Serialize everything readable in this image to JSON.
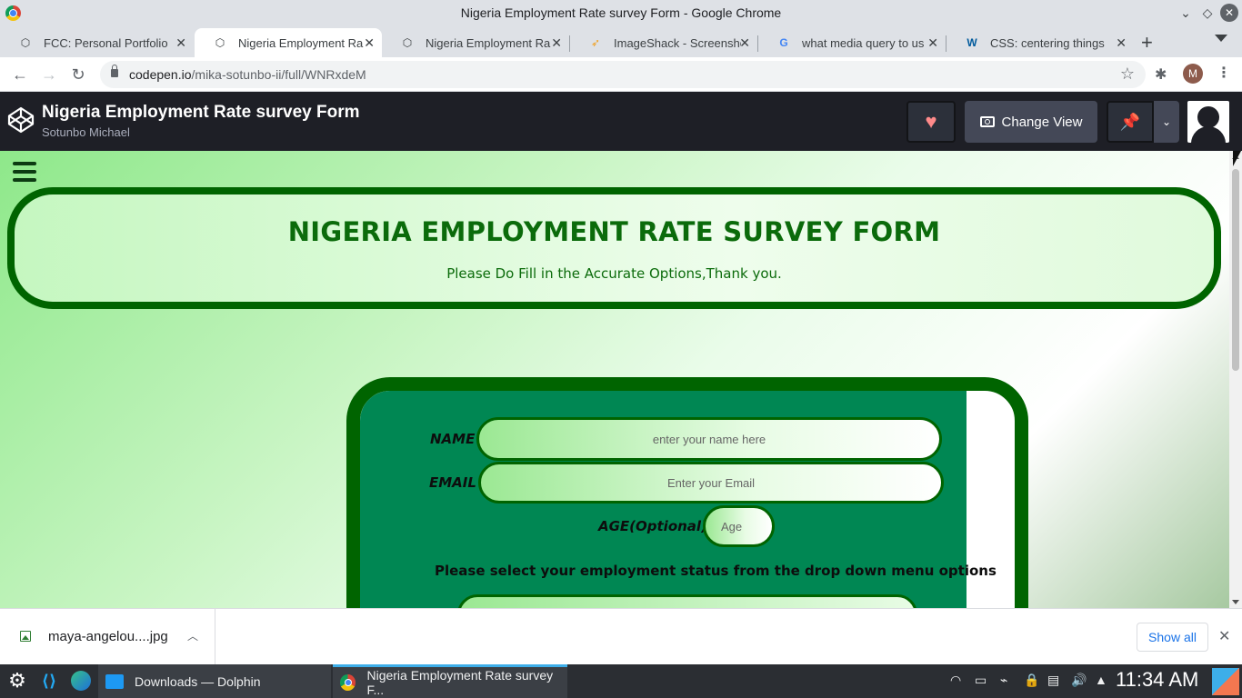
{
  "window": {
    "title": "Nigeria Employment Rate survey Form - Google Chrome"
  },
  "tabs": [
    {
      "label": "FCC: Personal Portfolio",
      "icon": "codepen-icon",
      "active": false
    },
    {
      "label": "Nigeria Employment Ra",
      "icon": "codepen-icon",
      "active": true
    },
    {
      "label": "Nigeria Employment Ra",
      "icon": "codepen-icon",
      "active": false
    },
    {
      "label": "ImageShack - Screensho",
      "icon": "imageshack-icon",
      "active": false
    },
    {
      "label": "what media query to us",
      "icon": "google-icon",
      "active": false
    },
    {
      "label": "CSS: centering things",
      "icon": "w3c-icon",
      "active": false
    }
  ],
  "toolbar": {
    "url_host": "codepen.io",
    "url_path": "/mika-sotunbo-ii/full/WNRxdeM",
    "profile_initial": "M"
  },
  "codepen": {
    "title": "Nigeria Employment Rate survey Form",
    "author": "Sotunbo Michael",
    "change_view_label": "Change View"
  },
  "page": {
    "heading": "NIGERIA EMPLOYMENT RATE SURVEY FORM",
    "subheading": "Please Do Fill in the Accurate Options,Thank you.",
    "form": {
      "name_label": "NAME",
      "name_placeholder": "enter your name here",
      "email_label": "EMAIL",
      "email_placeholder": "Enter your Email",
      "age_label": "AGE(Optional)",
      "age_placeholder": "Age",
      "status_prompt": "Please select your employment status from the drop down menu options"
    }
  },
  "downloads": {
    "file_name": "maya-angelou....jpg",
    "show_all_label": "Show all"
  },
  "taskbar": {
    "task1_label": "Downloads — Dolphin",
    "task2_label": "Nigeria Employment Rate survey F...",
    "clock": "11:34 AM"
  },
  "colors": {
    "form_green": "#008753",
    "border_green": "#006400",
    "heading_green": "#0b6b0b",
    "codepen_bar": "#1e1f26"
  }
}
